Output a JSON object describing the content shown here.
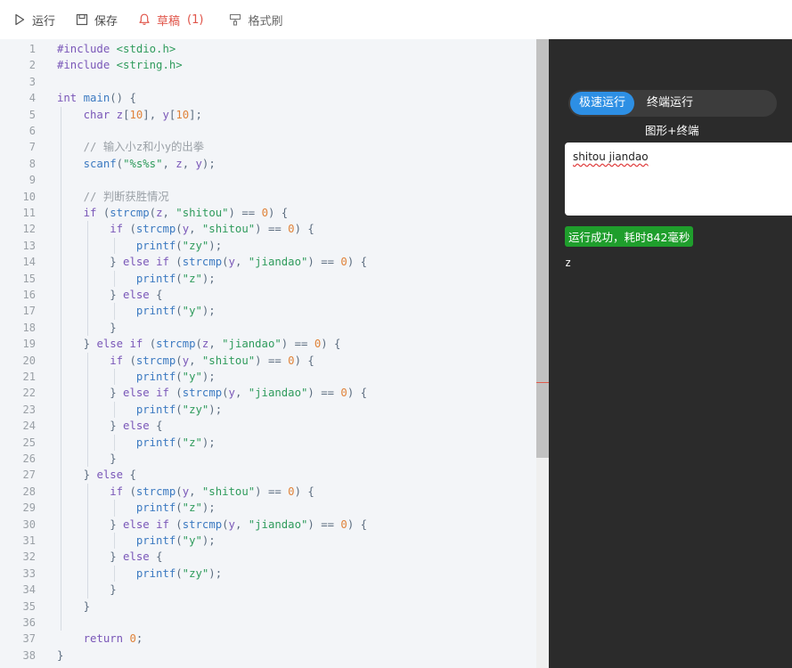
{
  "toolbar": {
    "run_label": "运行",
    "save_label": "保存",
    "draft_label": "草稿",
    "draft_count": "(1)",
    "format_label": "格式刷"
  },
  "editor": {
    "lines": [
      "#include <stdio.h>",
      "#include <string.h>",
      "",
      "int main() {",
      "    char z[10], y[10];",
      "",
      "    // 输入小z和小y的出拳",
      "    scanf(\"%s%s\", z, y);",
      "",
      "    // 判断获胜情况",
      "    if (strcmp(z, \"shitou\") == 0) {",
      "        if (strcmp(y, \"shitou\") == 0) {",
      "            printf(\"zy\");",
      "        } else if (strcmp(y, \"jiandao\") == 0) {",
      "            printf(\"z\");",
      "        } else {",
      "            printf(\"y\");",
      "        }",
      "    } else if (strcmp(z, \"jiandao\") == 0) {",
      "        if (strcmp(y, \"shitou\") == 0) {",
      "            printf(\"y\");",
      "        } else if (strcmp(y, \"jiandao\") == 0) {",
      "            printf(\"zy\");",
      "        } else {",
      "            printf(\"z\");",
      "        }",
      "    } else {",
      "        if (strcmp(y, \"shitou\") == 0) {",
      "            printf(\"z\");",
      "        } else if (strcmp(y, \"jiandao\") == 0) {",
      "            printf(\"y\");",
      "        } else {",
      "            printf(\"zy\");",
      "        }",
      "    }",
      "",
      "    return 0;",
      "}"
    ]
  },
  "run_panel": {
    "mode_fast": "极速运行",
    "mode_terminal": "终端运行",
    "mode_sub": "图形+终端",
    "input_text": "shitou jiandao",
    "status_text": "运行成功，耗时842毫秒",
    "output_text": "z"
  },
  "colors": {
    "accent": "#2d8fe4",
    "success": "#1f9e2c",
    "draft": "#e0554a"
  }
}
